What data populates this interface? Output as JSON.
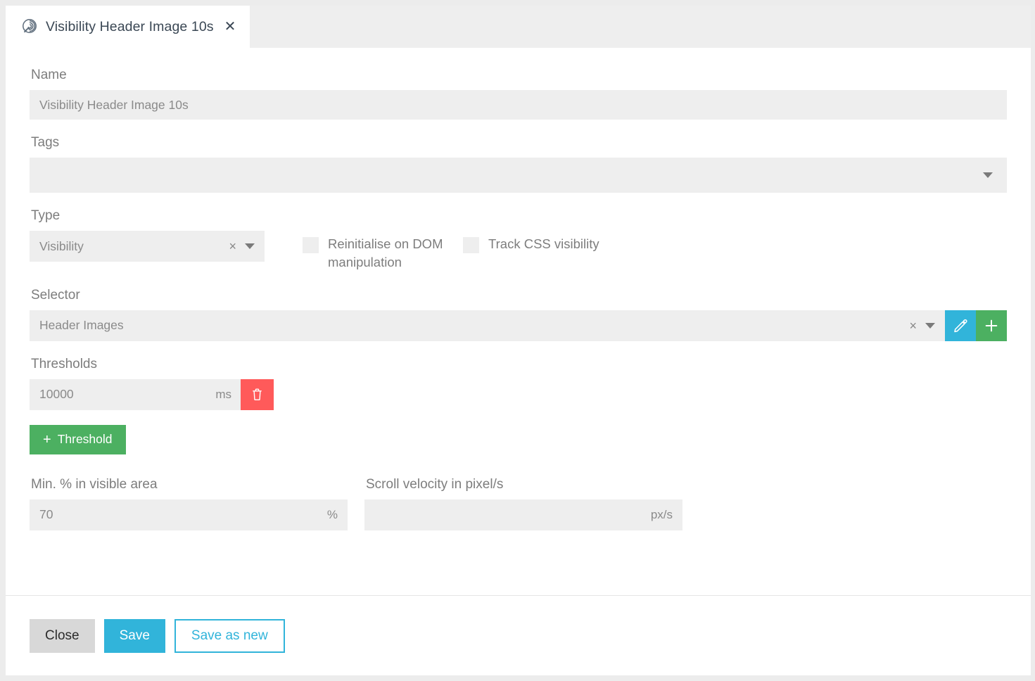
{
  "tab": {
    "icon": "visibility-target-icon",
    "title": "Visibility Header Image 10s",
    "close_label": "✕"
  },
  "form": {
    "name": {
      "label": "Name",
      "value": "Visibility Header Image 10s",
      "placeholder": "Name"
    },
    "tags": {
      "label": "Tags",
      "value": "",
      "placeholder": ""
    },
    "type": {
      "label": "Type",
      "value": "Visibility",
      "clear_label": "×",
      "checkbox_reinit": {
        "label": "Reinitialise on DOM manipulation",
        "checked": false
      },
      "checkbox_css": {
        "label": "Track CSS visibility",
        "checked": false
      }
    },
    "selector": {
      "label": "Selector",
      "value": "Header Images",
      "clear_label": "×",
      "edit_icon": "pencil-icon",
      "add_icon": "plus-icon"
    },
    "thresholds": {
      "label": "Thresholds",
      "rows": [
        {
          "value": "10000",
          "unit": "ms",
          "delete_icon": "trash-icon"
        }
      ],
      "add_button": "Threshold",
      "add_button_glyph": "+"
    },
    "min_visible": {
      "label": "Min. % in visible area",
      "value": "70",
      "unit": "%"
    },
    "scroll_velocity": {
      "label": "Scroll velocity in pixel/s",
      "value": "",
      "unit": "px/s"
    }
  },
  "footer": {
    "close": "Close",
    "save": "Save",
    "save_as_new": "Save as new"
  },
  "colors": {
    "accent_cyan": "#31b4da",
    "green": "#4cb061",
    "red": "#ff5a5a",
    "field_bg": "#eeeeee",
    "label_gray": "#7d7d7d"
  }
}
